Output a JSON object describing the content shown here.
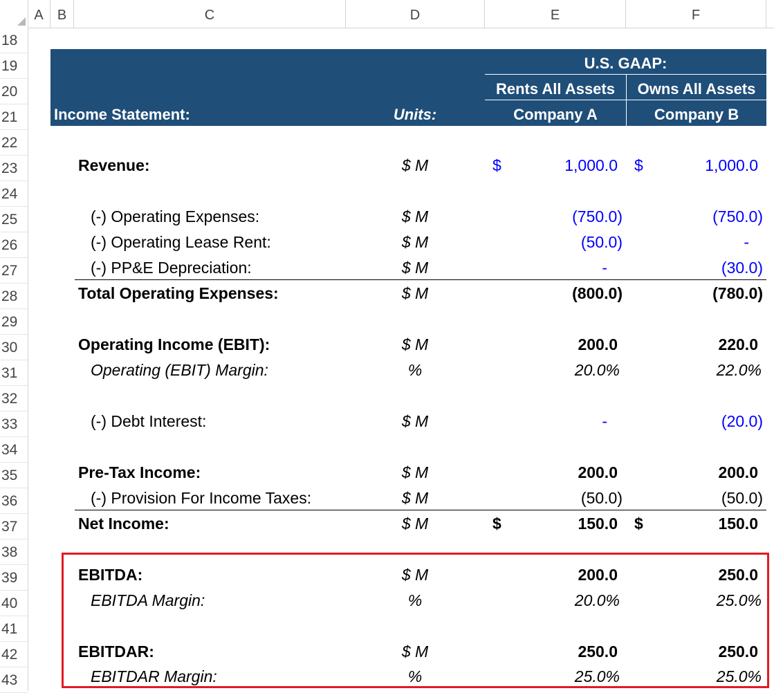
{
  "columns": [
    "A",
    "B",
    "C",
    "D",
    "E",
    "F"
  ],
  "rows": [
    "18",
    "19",
    "20",
    "21",
    "22",
    "23",
    "24",
    "25",
    "26",
    "27",
    "28",
    "29",
    "30",
    "31",
    "32",
    "33",
    "34",
    "35",
    "36",
    "37",
    "38",
    "39",
    "40",
    "41",
    "42",
    "43"
  ],
  "header": {
    "gaap": "U.S. GAAP:",
    "col_e_sub": "Rents All Assets",
    "col_f_sub": "Owns All Assets",
    "income_statement": "Income Statement:",
    "units": "Units:",
    "company_a": "Company A",
    "company_b": "Company B"
  },
  "symbols": {
    "dollar": "$"
  },
  "lines": {
    "revenue": {
      "label": "Revenue:",
      "unit": "$ M",
      "a": "1,000.0",
      "b": "1,000.0"
    },
    "opex": {
      "label": "(-) Operating Expenses:",
      "unit": "$ M",
      "a": "(750.0)",
      "b": "(750.0)"
    },
    "lease": {
      "label": "(-) Operating Lease Rent:",
      "unit": "$ M",
      "a": "(50.0)",
      "b": "-"
    },
    "depr": {
      "label": "(-) PP&E Depreciation:",
      "unit": "$ M",
      "a": "-",
      "b": "(30.0)"
    },
    "total_opex": {
      "label": "Total Operating Expenses:",
      "unit": "$ M",
      "a": "(800.0)",
      "b": "(780.0)"
    },
    "ebit": {
      "label": "Operating Income (EBIT):",
      "unit": "$ M",
      "a": "200.0",
      "b": "220.0"
    },
    "ebit_margin": {
      "label": "Operating (EBIT) Margin:",
      "unit": "%",
      "a": "20.0%",
      "b": "22.0%"
    },
    "interest": {
      "label": "(-) Debt Interest:",
      "unit": "$ M",
      "a": "-",
      "b": "(20.0)"
    },
    "pretax": {
      "label": "Pre-Tax Income:",
      "unit": "$ M",
      "a": "200.0",
      "b": "200.0"
    },
    "taxes": {
      "label": "(-) Provision For Income Taxes:",
      "unit": "$ M",
      "a": "(50.0)",
      "b": "(50.0)"
    },
    "net_income": {
      "label": "Net Income:",
      "unit": "$ M",
      "a": "150.0",
      "b": "150.0"
    },
    "ebitda": {
      "label": "EBITDA:",
      "unit": "$ M",
      "a": "200.0",
      "b": "250.0"
    },
    "ebitda_margin": {
      "label": "EBITDA Margin:",
      "unit": "%",
      "a": "20.0%",
      "b": "25.0%"
    },
    "ebitdar": {
      "label": "EBITDAR:",
      "unit": "$ M",
      "a": "250.0",
      "b": "250.0"
    },
    "ebitdar_margin": {
      "label": "EBITDAR Margin:",
      "unit": "%",
      "a": "25.0%",
      "b": "25.0%"
    }
  },
  "colors": {
    "header_bg": "#1f4e79",
    "input_blue": "#0000ff",
    "highlight_border": "#e11b22"
  }
}
